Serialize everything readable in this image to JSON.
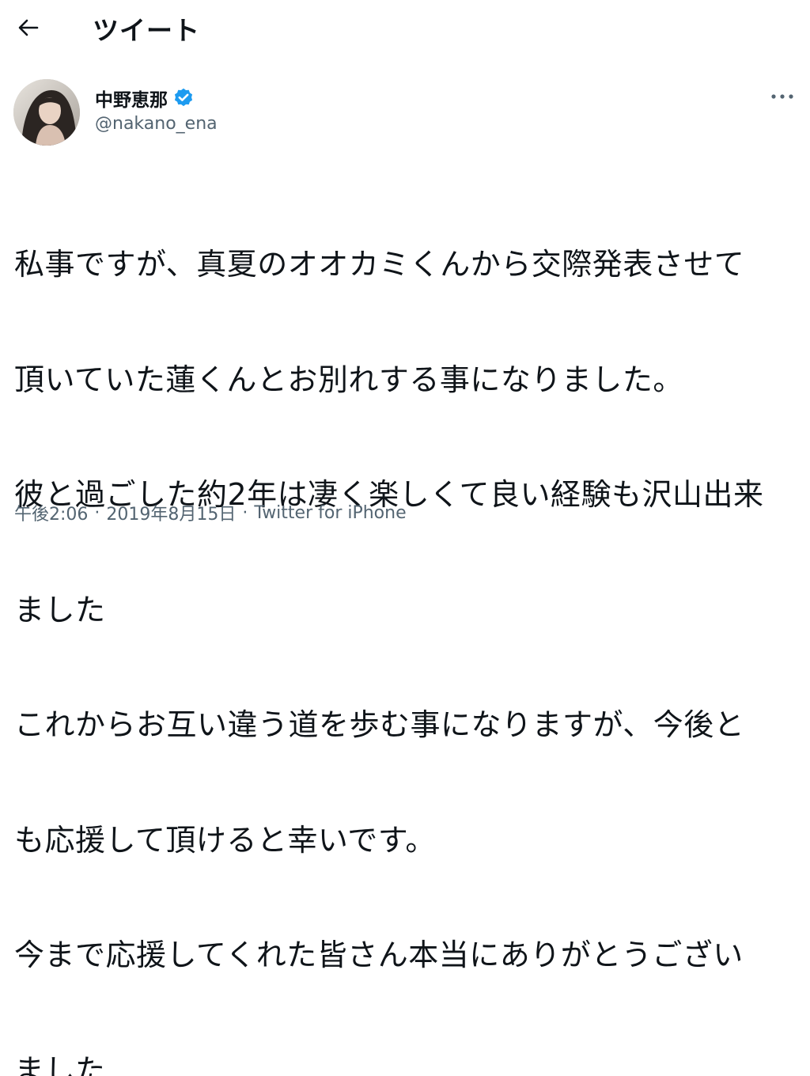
{
  "header": {
    "back_icon": "arrow-left-icon",
    "title": "ツイート"
  },
  "author": {
    "display_name": "中野恵那",
    "verified_icon": "verified-badge-icon",
    "verified_color": "#1d9bf0",
    "handle": "@nakano_ena",
    "avatar": "avatar-photo"
  },
  "more_icon": "more-horizontal-icon",
  "tweet": {
    "lines": [
      "私事ですが、真夏のオオカミくんから交際発表させて",
      "頂いていた蓮くんとお別れする事になりました。",
      "彼と過ごした約2年は凄く楽しくて良い経験も沢山出来",
      "ました",
      "これからお互い違う道を歩む事になりますが、今後と",
      "も応援して頂けると幸いです。",
      "今まで応援してくれた皆さん本当にありがとうござい",
      "ました"
    ]
  },
  "meta": {
    "time": "午後2:06",
    "separator": "·",
    "date": "2019年8月15日",
    "source": "Twitter for iPhone"
  },
  "colors": {
    "text": "#0f1419",
    "secondary": "#536471"
  }
}
